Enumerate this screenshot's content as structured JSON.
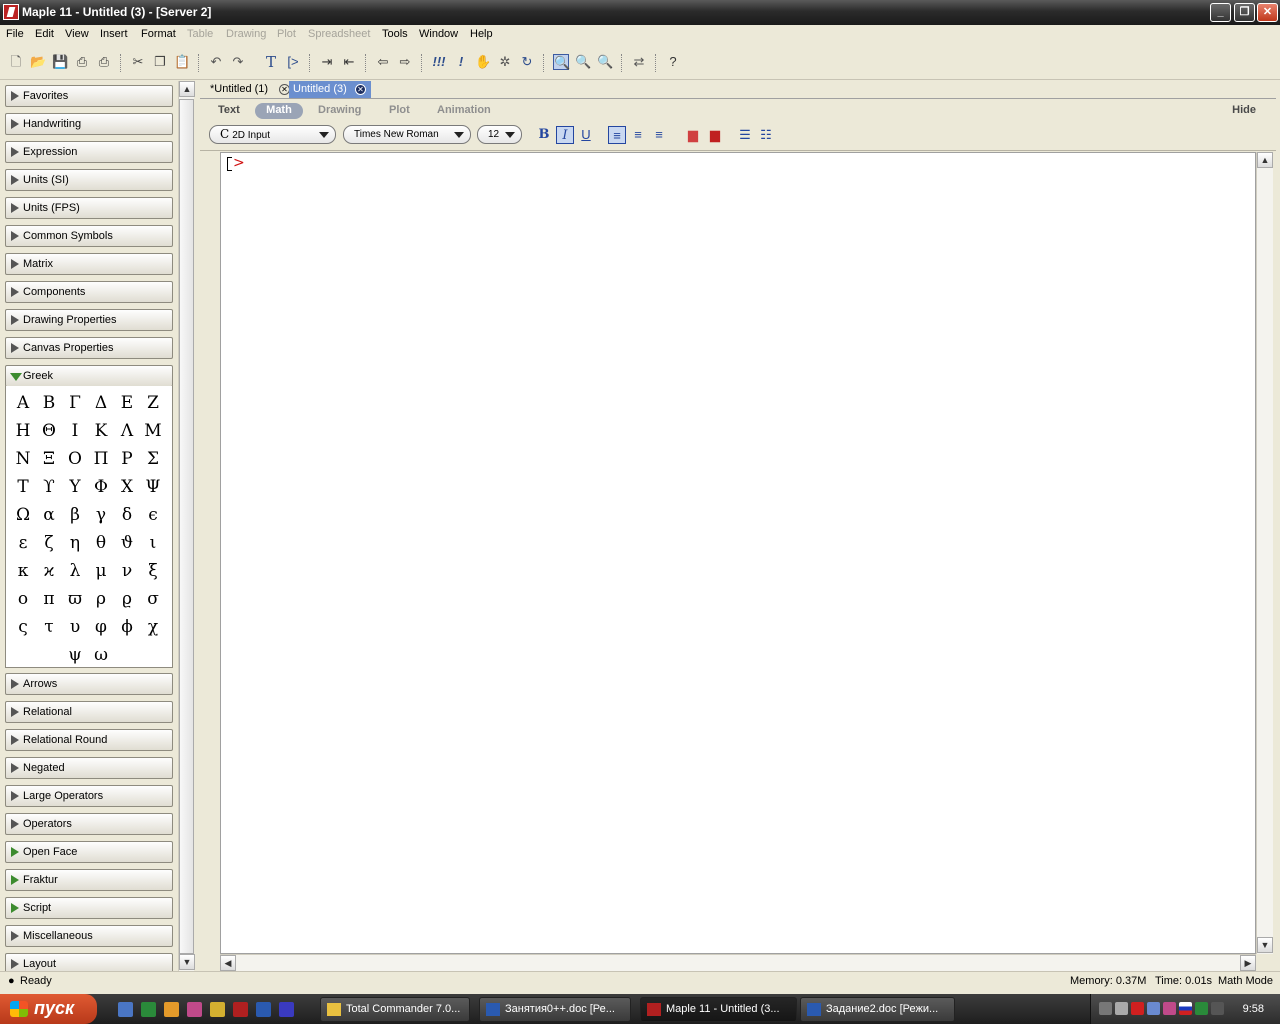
{
  "window": {
    "title": "Maple 11 - Untitled (3) - [Server 2]"
  },
  "menu": {
    "items": [
      {
        "label": "File",
        "enabled": true
      },
      {
        "label": "Edit",
        "enabled": true
      },
      {
        "label": "View",
        "enabled": true
      },
      {
        "label": "Insert",
        "enabled": true
      },
      {
        "label": "Format",
        "enabled": true
      },
      {
        "label": "Table",
        "enabled": false
      },
      {
        "label": "Drawing",
        "enabled": false
      },
      {
        "label": "Plot",
        "enabled": false
      },
      {
        "label": "Spreadsheet",
        "enabled": false
      },
      {
        "label": "Tools",
        "enabled": true
      },
      {
        "label": "Window",
        "enabled": true
      },
      {
        "label": "Help",
        "enabled": true
      }
    ]
  },
  "palettes": {
    "top": [
      "Favorites",
      "Handwriting",
      "Expression",
      "Units (SI)",
      "Units (FPS)",
      "Common Symbols",
      "Matrix",
      "Components",
      "Drawing Properties",
      "Canvas Properties"
    ],
    "open": "Greek",
    "greek_symbols": [
      "Α",
      "Β",
      "Γ",
      "Δ",
      "Ε",
      "Ζ",
      "Η",
      "Θ",
      "Ι",
      "Κ",
      "Λ",
      "Μ",
      "Ν",
      "Ξ",
      "Ο",
      "Π",
      "Ρ",
      "Σ",
      "Τ",
      "ϒ",
      "Υ",
      "Φ",
      "Χ",
      "Ψ",
      "Ω",
      "α",
      "β",
      "γ",
      "δ",
      "ϵ",
      "ε",
      "ζ",
      "η",
      "θ",
      "ϑ",
      "ι",
      "κ",
      "ϰ",
      "λ",
      "μ",
      "ν",
      "ξ",
      "ο",
      "π",
      "ϖ",
      "ρ",
      "ϱ",
      "σ",
      "ς",
      "τ",
      "υ",
      "φ",
      "ϕ",
      "χ",
      "ψ",
      "ω"
    ],
    "bottom": [
      "Arrows",
      "Relational",
      "Relational Round",
      "Negated",
      "Large Operators",
      "Operators",
      "Open Face",
      "Fraktur",
      "Script",
      "Miscellaneous",
      "Layout"
    ]
  },
  "doc_tabs": [
    {
      "label": "*Untitled (1)",
      "active": false
    },
    {
      "label": "Untitled (3)",
      "active": true
    }
  ],
  "context_bar": {
    "modes": [
      {
        "label": "Text",
        "state": "on"
      },
      {
        "label": "Math",
        "state": "active"
      },
      {
        "label": "Drawing",
        "state": "off"
      },
      {
        "label": "Plot",
        "state": "off"
      },
      {
        "label": "Animation",
        "state": "off"
      }
    ],
    "hide_label": "Hide",
    "input_mode": "2D Input",
    "input_mode_prefix": "C",
    "font": "Times New Roman",
    "size": "12",
    "bold": "B",
    "italic": "I",
    "underline": "U"
  },
  "worksheet": {
    "prompt": ">"
  },
  "status": {
    "state": "Ready",
    "memory": "Memory: 0.37M",
    "time": "Time: 0.01s",
    "mode": "Math Mode"
  },
  "taskbar": {
    "start_label": "пуск",
    "tasks": [
      {
        "label": "Total Commander 7.0...",
        "active": false
      },
      {
        "label": "Занятия0++.doc [Ре...",
        "active": false
      },
      {
        "label": "Maple 11 - Untitled (3...",
        "active": true
      },
      {
        "label": "Задание2.doc [Режи...",
        "active": false
      }
    ],
    "clock": "9:58"
  },
  "colors": {
    "prompt": "#d01010",
    "active_tab": "#6b8fcf",
    "taskbar": "#2b2b2b",
    "start": "#c9461f"
  }
}
